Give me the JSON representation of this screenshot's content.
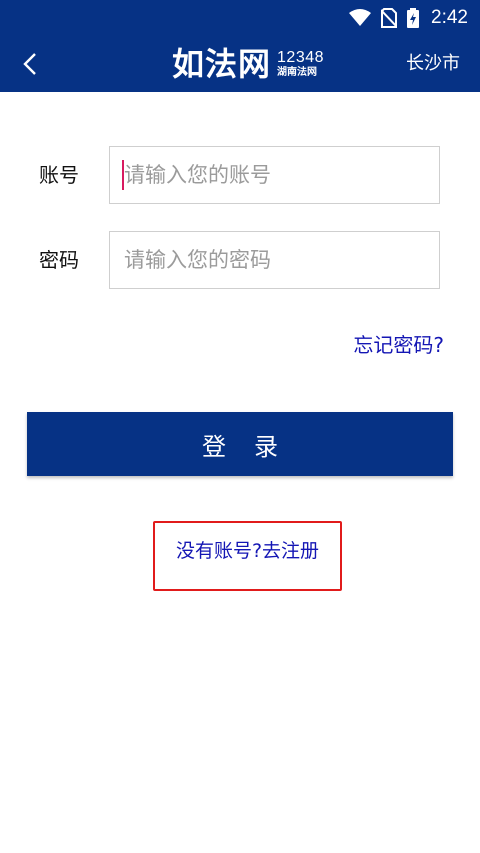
{
  "status_bar": {
    "time": "2:42",
    "icons": [
      "wifi-icon",
      "no-sim-icon",
      "battery-charging-icon"
    ]
  },
  "app_bar": {
    "back_icon": "chevron-left-icon",
    "logo_main": "如法网",
    "logo_number": "12348",
    "logo_name": "湖南法网",
    "city": "长沙市"
  },
  "form": {
    "account_label": "账号",
    "account_placeholder": "请输入您的账号",
    "password_label": "密码",
    "password_placeholder": "请输入您的密码"
  },
  "forgot_password": "忘记密码?",
  "login_label": "登录",
  "register_link": "没有账号?去注册",
  "colors": {
    "primary": "#063285",
    "link": "#1416b4",
    "highlight": "#e11b1b"
  }
}
